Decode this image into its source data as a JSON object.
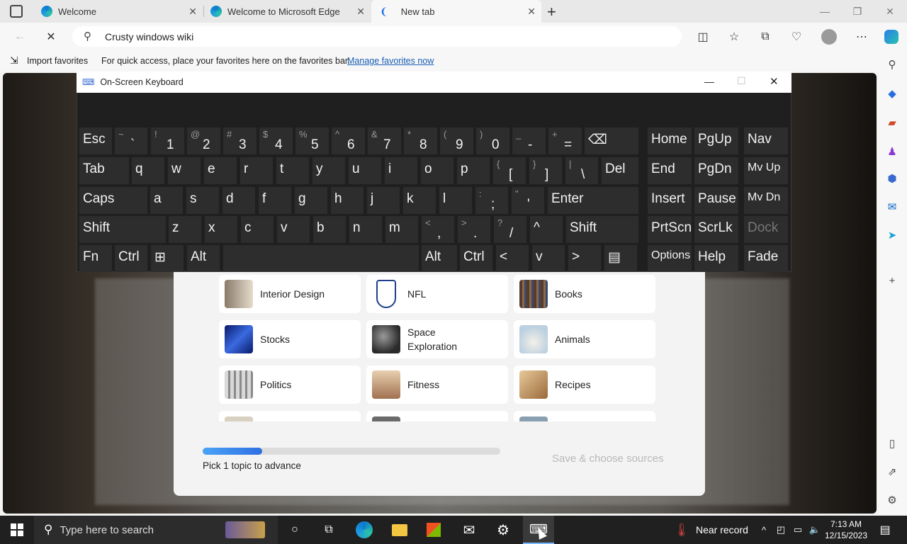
{
  "browser": {
    "tabs": [
      {
        "label": "Welcome"
      },
      {
        "label": "Welcome to Microsoft Edge"
      },
      {
        "label": "New tab"
      }
    ],
    "address": "Crusty windows wiki",
    "favorites_bar": {
      "import_label": "Import favorites",
      "message": "For quick access, place your favorites here on the favorites bar.",
      "manage_link": "Manage favorites now"
    }
  },
  "osk": {
    "title": "On-Screen Keyboard",
    "rows": [
      [
        {
          "main": "Esc"
        },
        {
          "shift": "~",
          "low": "`"
        },
        {
          "shift": "!",
          "low": "1"
        },
        {
          "shift": "@",
          "low": "2"
        },
        {
          "shift": "#",
          "low": "3"
        },
        {
          "shift": "$",
          "low": "4"
        },
        {
          "shift": "%",
          "low": "5"
        },
        {
          "shift": "^",
          "low": "6"
        },
        {
          "shift": "&",
          "low": "7"
        },
        {
          "shift": "*",
          "low": "8"
        },
        {
          "shift": "(",
          "low": "9"
        },
        {
          "shift": ")",
          "low": "0"
        },
        {
          "shift": "_",
          "low": "-"
        },
        {
          "shift": "+",
          "low": "="
        },
        {
          "main": "⌫"
        },
        {
          "main": "Home"
        },
        {
          "main": "PgUp"
        },
        {
          "main": "Nav"
        }
      ],
      [
        {
          "main": "Tab"
        },
        {
          "main": "q"
        },
        {
          "main": "w"
        },
        {
          "main": "e"
        },
        {
          "main": "r"
        },
        {
          "main": "t"
        },
        {
          "main": "y"
        },
        {
          "main": "u"
        },
        {
          "main": "i"
        },
        {
          "main": "o"
        },
        {
          "main": "p"
        },
        {
          "shift": "{",
          "low": "["
        },
        {
          "shift": "}",
          "low": "]"
        },
        {
          "shift": "|",
          "low": "\\"
        },
        {
          "main": "Del"
        },
        {
          "main": "End"
        },
        {
          "main": "PgDn"
        },
        {
          "main": "Mv Up"
        }
      ],
      [
        {
          "main": "Caps"
        },
        {
          "main": "a"
        },
        {
          "main": "s"
        },
        {
          "main": "d"
        },
        {
          "main": "f"
        },
        {
          "main": "g"
        },
        {
          "main": "h"
        },
        {
          "main": "j"
        },
        {
          "main": "k"
        },
        {
          "main": "l"
        },
        {
          "shift": ":",
          "low": ";"
        },
        {
          "shift": "\"",
          "low": "'"
        },
        {
          "main": "Enter"
        },
        {
          "main": "Insert"
        },
        {
          "main": "Pause"
        },
        {
          "main": "Mv Dn"
        }
      ],
      [
        {
          "main": "Shift"
        },
        {
          "main": "z"
        },
        {
          "main": "x"
        },
        {
          "main": "c"
        },
        {
          "main": "v"
        },
        {
          "main": "b"
        },
        {
          "main": "n"
        },
        {
          "main": "m"
        },
        {
          "shift": "<",
          "low": ","
        },
        {
          "shift": ">",
          "low": "."
        },
        {
          "shift": "?",
          "low": "/"
        },
        {
          "main": "^"
        },
        {
          "main": "Shift"
        },
        {
          "main": "PrtScn"
        },
        {
          "main": "ScrLk"
        },
        {
          "main": "Dock"
        }
      ],
      [
        {
          "main": "Fn"
        },
        {
          "main": "Ctrl"
        },
        {
          "main": "⊞"
        },
        {
          "main": "Alt"
        },
        {
          "main": ""
        },
        {
          "main": "Alt"
        },
        {
          "main": "Ctrl"
        },
        {
          "main": "<"
        },
        {
          "main": "v"
        },
        {
          "main": ">"
        },
        {
          "main": "▤"
        },
        {
          "main": "Options"
        },
        {
          "main": "Help"
        },
        {
          "main": "Fade"
        }
      ]
    ]
  },
  "topics": [
    {
      "label": "Interior Design",
      "color": "#c8b8a0"
    },
    {
      "label": "NFL",
      "color": "#ffffff"
    },
    {
      "label": "Books",
      "color": "#6b4a3a"
    },
    {
      "label": "Stocks",
      "color": "#1a3a9a"
    },
    {
      "label": "Space Exploration",
      "color": "#555555"
    },
    {
      "label": "Animals",
      "color": "#cfe0ee"
    },
    {
      "label": "Politics",
      "color": "#9a9a9a"
    },
    {
      "label": "Fitness",
      "color": "#d0a070"
    },
    {
      "label": "Recipes",
      "color": "#b88a5a"
    }
  ],
  "progress": {
    "label": "Pick 1 topic to advance",
    "fraction": 0.2,
    "save_label": "Save & choose sources"
  },
  "taskbar": {
    "search_placeholder": "Type here to search",
    "weather": "Near record",
    "time": "7:13 AM",
    "date": "12/15/2023"
  }
}
